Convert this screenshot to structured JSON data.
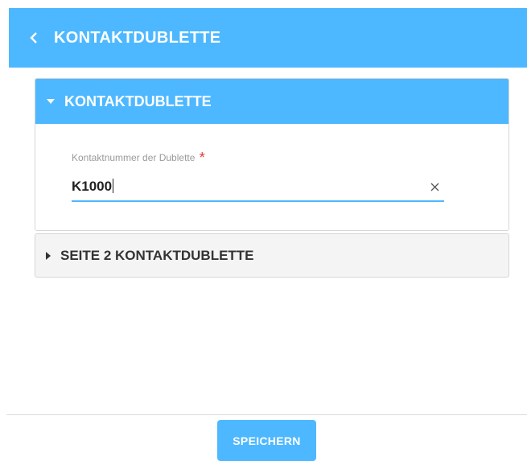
{
  "header": {
    "back_icon": "chevron-left-icon",
    "title": "KONTAKTDUBLETTE"
  },
  "sections": [
    {
      "title": "KONTAKTDUBLETTE",
      "expanded": true,
      "field": {
        "label": "Kontaktnummer der Dublette",
        "required_marker": "*",
        "value": "K1000",
        "clear_icon": "close-icon"
      }
    },
    {
      "title": "SEITE 2 KONTAKTDUBLETTE",
      "expanded": false
    }
  ],
  "footer": {
    "save_label": "SPEICHERN"
  },
  "colors": {
    "accent": "#4db8ff",
    "required": "#e53935"
  }
}
